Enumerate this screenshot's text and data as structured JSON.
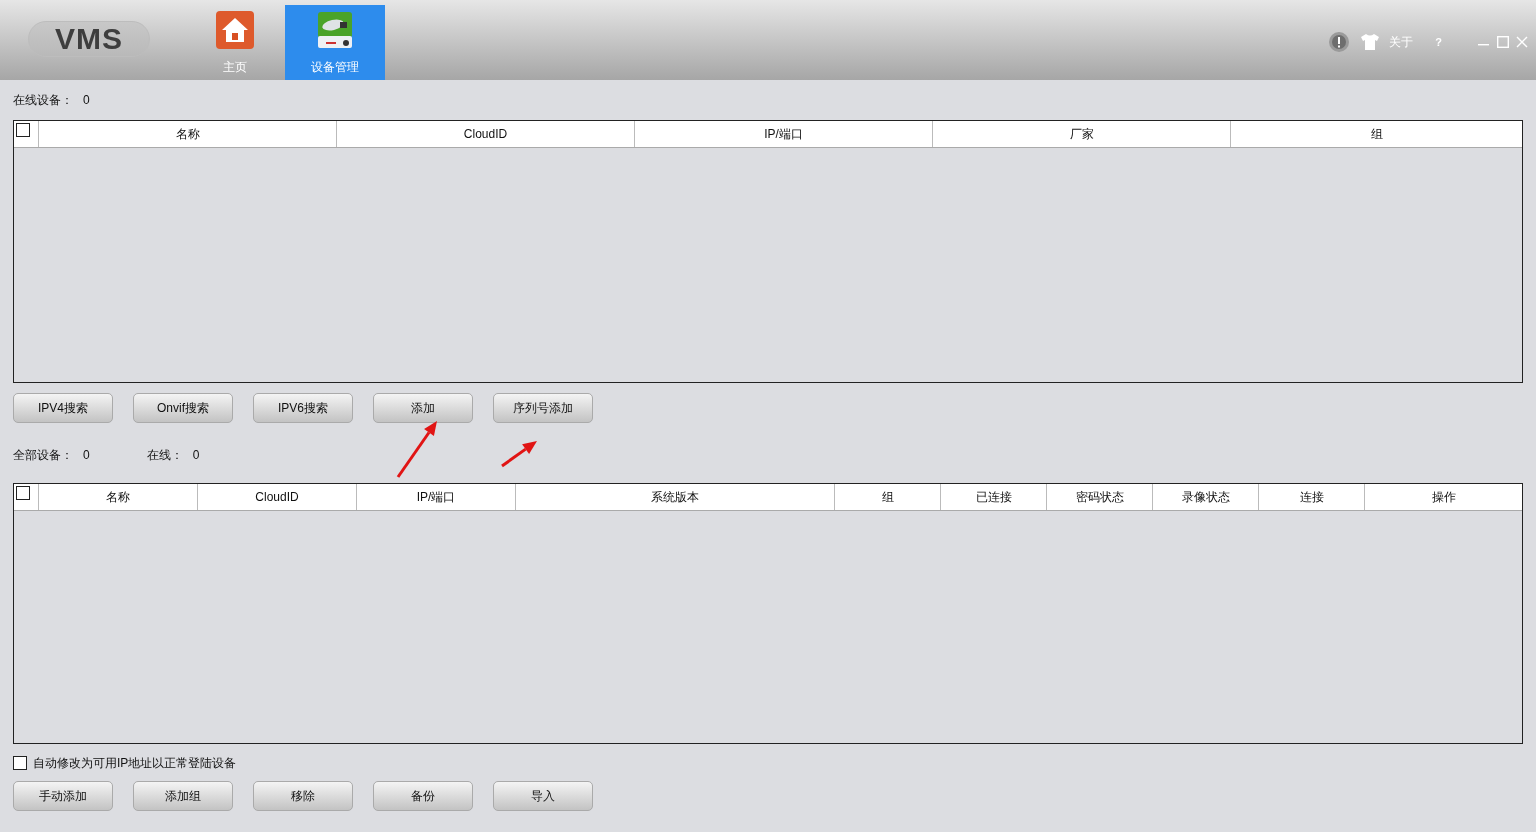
{
  "app": {
    "logo": "VMS"
  },
  "nav_tabs": [
    {
      "label": "主页",
      "kind": "home",
      "selected": false
    },
    {
      "label": "设备管理",
      "kind": "device",
      "selected": true
    }
  ],
  "title_bar": {
    "about": "关于",
    "help": "?"
  },
  "online_devices": {
    "label": "在线设备：",
    "count": "0",
    "columns": [
      "名称",
      "CloudID",
      "IP/端口",
      "厂家",
      "组"
    ],
    "select_all_checked": false,
    "buttons": [
      "IPV4搜索",
      "Onvif搜索",
      "IPV6搜索",
      "添加",
      "序列号添加"
    ]
  },
  "annotations": [
    {
      "kind": "arrow"
    },
    {
      "kind": "arrow"
    }
  ],
  "all_devices": {
    "label": "全部设备：",
    "count": "0",
    "online_label": "在线：",
    "online_count": "0",
    "columns": [
      "名称",
      "CloudID",
      "IP/端口",
      "系统版本",
      "组",
      "已连接",
      "密码状态",
      "录像状态",
      "连接",
      "操作"
    ],
    "select_all_checked": false
  },
  "auto_fix": {
    "label": "自动修改为可用IP地址以正常登陆设备",
    "checked": false
  },
  "bottom_buttons": [
    "手动添加",
    "添加组",
    "移除",
    "备份",
    "导入"
  ]
}
